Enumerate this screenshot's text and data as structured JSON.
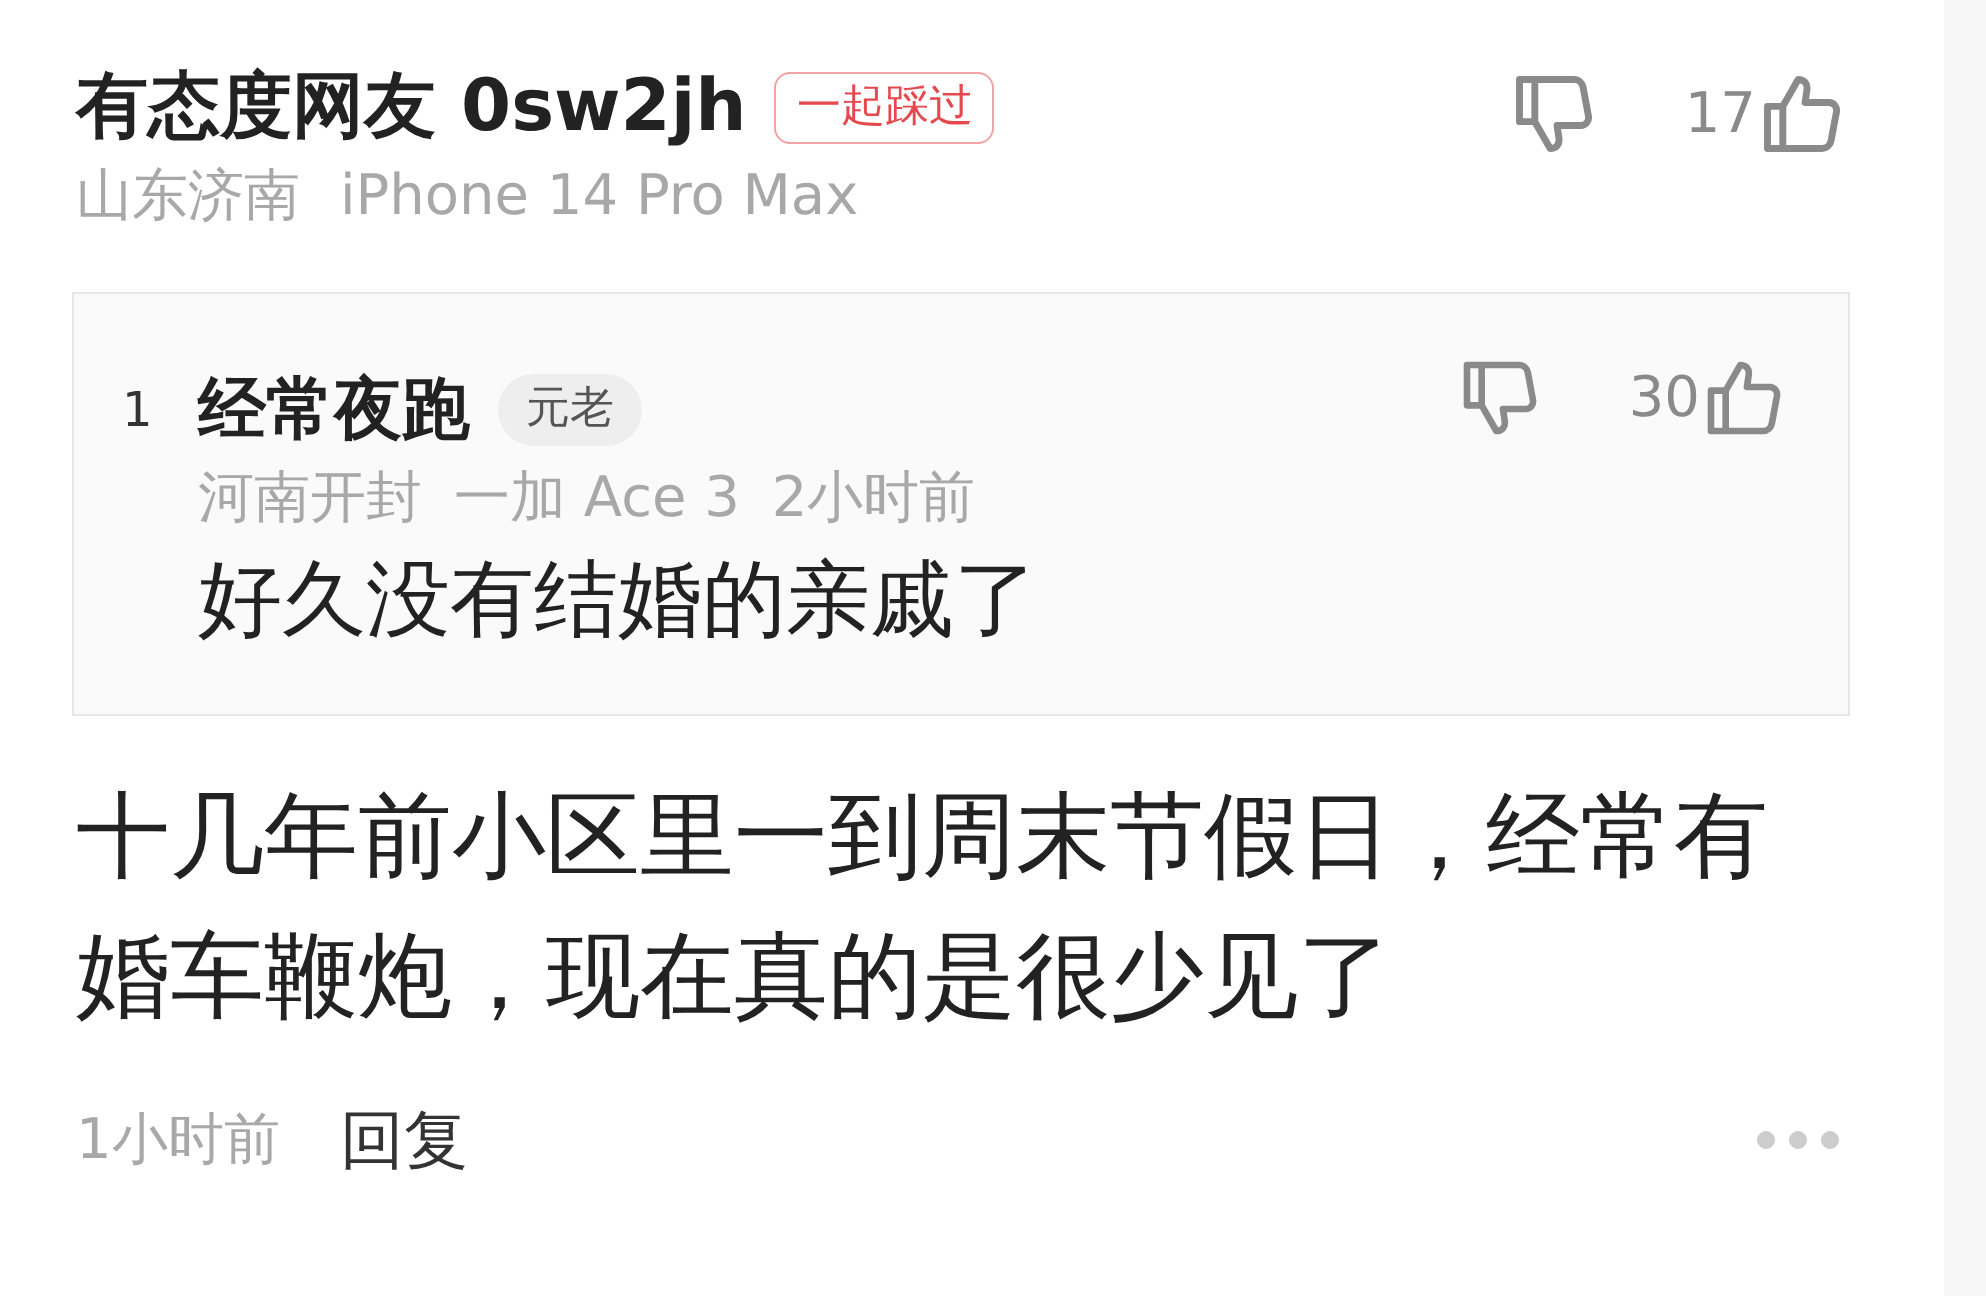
{
  "comment": {
    "author": "有态度网友 0sw2jh",
    "badge": "一起踩过",
    "location": "山东济南",
    "device": "iPhone 14 Pro Max",
    "likes": "17",
    "quoted_reply": {
      "index": "1",
      "author": "经常夜跑",
      "tag": "元老",
      "location": "河南开封",
      "device": "一加 Ace 3",
      "time": "2小时前",
      "text": "好久没有结婚的亲戚了",
      "likes": "30"
    },
    "body": "十几年前小区里一到周末节假日，经常有婚车鞭炮，现在真的是很少见了",
    "time": "1小时前",
    "reply_label": "回复"
  }
}
